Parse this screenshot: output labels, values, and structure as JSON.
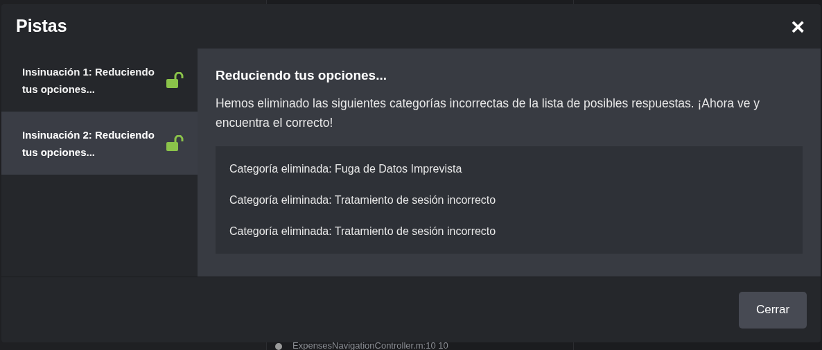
{
  "background": {
    "file_reference": "ExpensesNavigationController.m:10 10"
  },
  "dialog": {
    "title": "Pistas",
    "close": "×",
    "hints": [
      {
        "label": "Insinuación 1: Reduciendo tus opciones...",
        "unlocked": true,
        "selected": false
      },
      {
        "label": "Insinuación 2: Reduciendo tus opciones...",
        "unlocked": true,
        "selected": true
      }
    ],
    "content": {
      "heading": "Reduciendo tus opciones...",
      "body": "Hemos eliminado las siguientes categorías incorrectas de la lista de posibles respuestas. ¡Ahora ve y encuentra el correcto!",
      "items": [
        "Categoría eliminada: Fuga de Datos Imprevista",
        "Categoría eliminada: Tratamiento de sesión incorrecto",
        "Categoría eliminada: Tratamiento de sesión incorrecto"
      ]
    },
    "footer_button": "Cerrar"
  }
}
